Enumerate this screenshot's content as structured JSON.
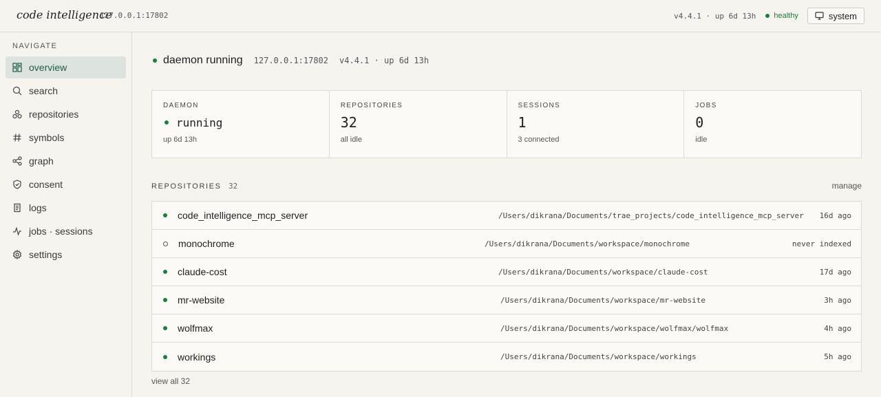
{
  "header": {
    "brand": "code intelligence",
    "host": "127.0.0.1:17802",
    "version_uptime": "v4.4.1 · up 6d 13h",
    "health": "healthy",
    "theme_label": "system"
  },
  "sidebar": {
    "title": "NAVIGATE",
    "items": [
      {
        "label": "overview",
        "icon": "dashboard-icon",
        "active": true
      },
      {
        "label": "search",
        "icon": "search-icon"
      },
      {
        "label": "repositories",
        "icon": "repositories-icon"
      },
      {
        "label": "symbols",
        "icon": "hash-icon"
      },
      {
        "label": "graph",
        "icon": "graph-icon"
      },
      {
        "label": "consent",
        "icon": "shield-icon"
      },
      {
        "label": "logs",
        "icon": "logs-icon"
      },
      {
        "label": "jobs · sessions",
        "icon": "activity-icon"
      },
      {
        "label": "settings",
        "icon": "gear-icon"
      }
    ]
  },
  "status": {
    "title": "daemon running",
    "host": "127.0.0.1:17802",
    "version_uptime": "v4.4.1 · up 6d 13h"
  },
  "stats": {
    "daemon": {
      "label": "DAEMON",
      "value": "running",
      "sub": "up 6d 13h"
    },
    "repositories": {
      "label": "REPOSITORIES",
      "value": "32",
      "sub": "all idle"
    },
    "sessions": {
      "label": "SESSIONS",
      "value": "1",
      "sub": "3 connected"
    },
    "jobs": {
      "label": "JOBS",
      "value": "0",
      "sub": "idle"
    }
  },
  "repos": {
    "title": "REPOSITORIES",
    "count": "32",
    "manage_label": "manage",
    "view_all_label": "view all 32",
    "rows": [
      {
        "name": "code_intelligence_mcp_server",
        "path": "/Users/dikrana/Documents/trae_projects/code_intelligence_mcp_server",
        "when": "16d ago",
        "indexed": true
      },
      {
        "name": "monochrome",
        "path": "/Users/dikrana/Documents/workspace/monochrome",
        "when": "never indexed",
        "indexed": false
      },
      {
        "name": "claude-cost",
        "path": "/Users/dikrana/Documents/workspace/claude-cost",
        "when": "17d ago",
        "indexed": true
      },
      {
        "name": "mr-website",
        "path": "/Users/dikrana/Documents/workspace/mr-website",
        "when": "3h ago",
        "indexed": true
      },
      {
        "name": "wolfmax",
        "path": "/Users/dikrana/Documents/workspace/wolfmax/wolfmax",
        "when": "4h ago",
        "indexed": true
      },
      {
        "name": "workings",
        "path": "/Users/dikrana/Documents/workspace/workings",
        "when": "5h ago",
        "indexed": true
      }
    ]
  },
  "colors": {
    "healthy": "#1e7a3e",
    "active_nav_bg": "#dde4df",
    "background": "#f5f4ef"
  }
}
